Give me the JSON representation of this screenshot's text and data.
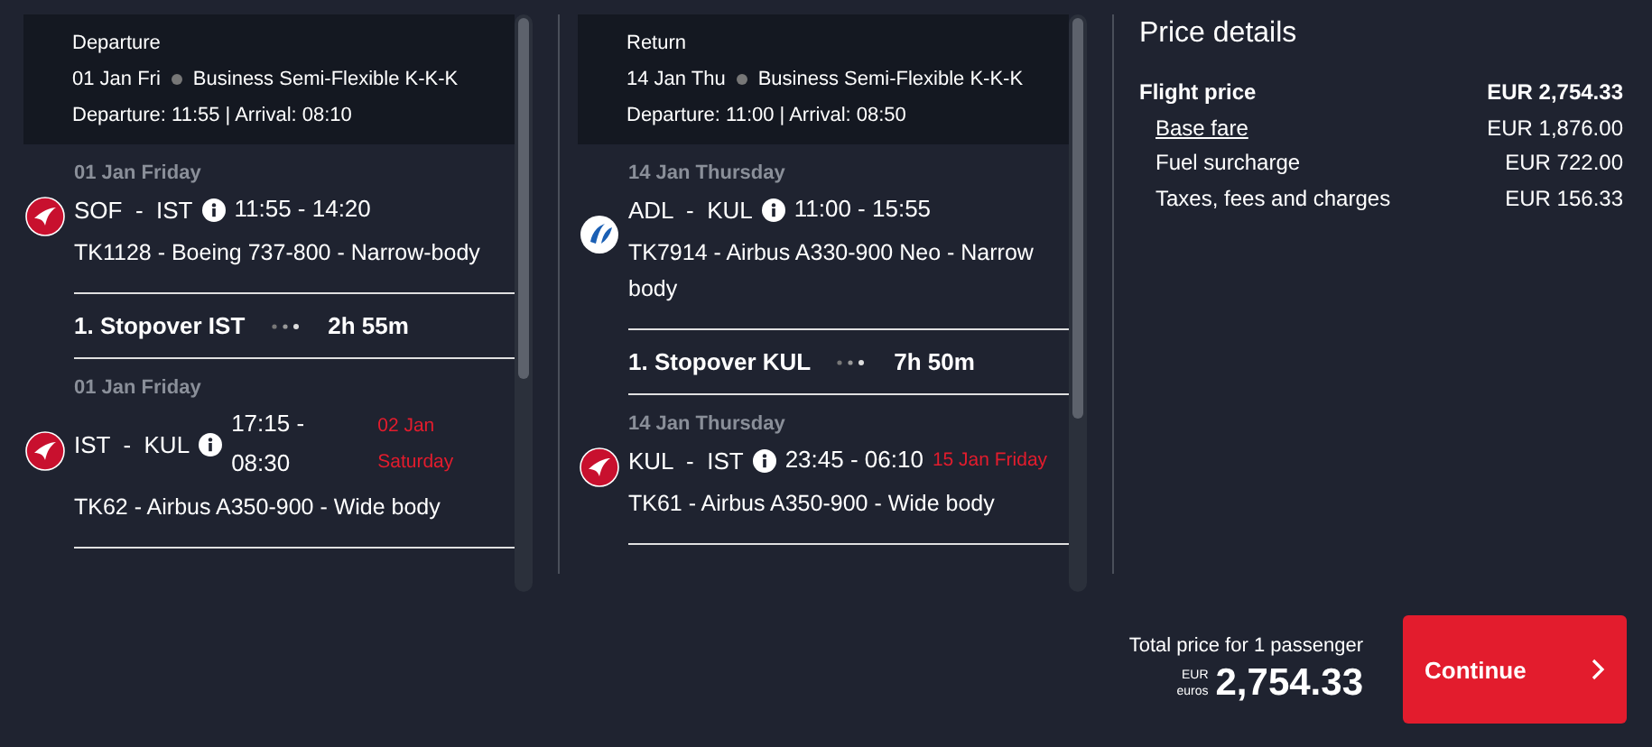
{
  "journeys": [
    {
      "header": {
        "title": "Departure",
        "date": "01 Jan Fri",
        "fare": "Business Semi-Flexible K-K-K",
        "times": "Departure: 11:55 | Arrival: 08:10"
      },
      "items": [
        {
          "kind": "flight",
          "partner_operated": false,
          "date": "01 Jan Friday",
          "route": "SOF  -  IST",
          "times": "11:55 - 14:20",
          "details": "TK1128 - Boeing 737-800 - Narrow-body"
        },
        {
          "kind": "stopover",
          "label": "1. Stopover IST",
          "duration": "2h 55m"
        },
        {
          "kind": "flight",
          "partner_operated": false,
          "date": "01 Jan Friday",
          "route": "IST  -  KUL",
          "times": "17:15 - 08:30",
          "arrival_date": "02 Jan Saturday",
          "details": "TK62 - Airbus A350-900 - Wide body"
        }
      ]
    },
    {
      "header": {
        "title": "Return",
        "date": "14 Jan Thu",
        "fare": "Business Semi-Flexible K-K-K",
        "times": "Departure: 11:00 | Arrival: 08:50"
      },
      "items": [
        {
          "kind": "flight",
          "partner_operated": true,
          "date": "14 Jan Thursday",
          "route": "ADL  -  KUL",
          "times": "11:00 - 15:55",
          "details": "TK7914 - Airbus A330-900 Neo - Narrow body"
        },
        {
          "kind": "stopover",
          "label": "1. Stopover KUL",
          "duration": "7h 50m"
        },
        {
          "kind": "flight",
          "partner_operated": false,
          "date": "14 Jan Thursday",
          "route": "KUL  -  IST",
          "times": "23:45 - 06:10",
          "arrival_date": "15 Jan Friday",
          "details": "TK61 - Airbus A350-900 - Wide body"
        }
      ]
    }
  ],
  "price_details": {
    "title": "Price details",
    "rows": [
      {
        "kind": "total",
        "label": "Flight price",
        "amount": "EUR 2,754.33"
      },
      {
        "kind": "link",
        "label": "Base fare",
        "amount": "EUR 1,876.00"
      },
      {
        "kind": "item",
        "label": "Fuel surcharge",
        "amount": "EUR 722.00"
      },
      {
        "kind": "item",
        "label": "Taxes, fees and charges",
        "amount": "EUR 156.33"
      }
    ]
  },
  "footer": {
    "total_label": "Total price for 1 passenger",
    "currency_code": "EUR",
    "currency_name": "euros",
    "total": "2,754.33",
    "button": "Continue"
  }
}
